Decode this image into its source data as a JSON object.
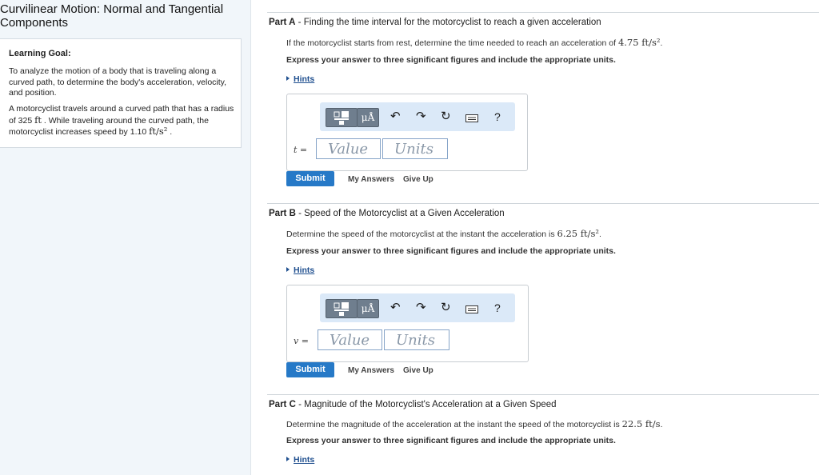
{
  "page": {
    "title": "Curvilinear Motion: Normal and Tangential Components"
  },
  "learning_goal": {
    "heading": "Learning Goal:",
    "text": "To analyze the motion of a body that is traveling along a curved path, to determine the body's acceleration, velocity, and position.",
    "problem_pre": "A motorcyclist travels around a curved path that has a radius of 325 ",
    "problem_unit1": "ft",
    "problem_mid": " . While traveling around the curved path, the motorcyclist increases speed by 1.10 ",
    "problem_unit2": "ft/s²",
    "problem_post": " ."
  },
  "toolbar": {
    "mu_label": "μÅ",
    "undo_icon": "undo-icon",
    "redo_icon": "redo-icon",
    "reset_icon": "reset-icon",
    "keyboard_icon": "keyboard-icon",
    "help_label": "?"
  },
  "parts": [
    {
      "label": "Part A",
      "title": "Finding the time interval for the motorcyclist to reach a given acceleration",
      "prompt_text": "If the motorcyclist starts from rest, determine the time needed to reach an acceleration of ",
      "prompt_math": "4.75 ft/s²",
      "prompt_end": ".",
      "instruction": "Express your answer to three significant figures and include the appropriate units.",
      "hints_label": "Hints",
      "variable": "t =",
      "value_placeholder": "Value",
      "units_placeholder": "Units",
      "submit_label": "Submit",
      "my_answers_label": "My Answers",
      "give_up_label": "Give Up"
    },
    {
      "label": "Part B",
      "title": "Speed of the Motorcyclist at a Given Acceleration",
      "prompt_text": "Determine the speed of the motorcyclist at the instant the acceleration is ",
      "prompt_math": "6.25 ft/s²",
      "prompt_end": ".",
      "instruction": "Express your answer to three significant figures and include the appropriate units.",
      "hints_label": "Hints",
      "variable": "v =",
      "value_placeholder": "Value",
      "units_placeholder": "Units",
      "submit_label": "Submit",
      "my_answers_label": "My Answers",
      "give_up_label": "Give Up"
    },
    {
      "label": "Part C",
      "title": "Magnitude of the Motorcyclist's Acceleration at a Given Speed",
      "prompt_text": "Determine the magnitude of the acceleration at the instant the speed of the motorcyclist is ",
      "prompt_math": "22.5 ft/s",
      "prompt_end": ".",
      "instruction": "Express your answer to three significant figures and include the appropriate units.",
      "hints_label": "Hints"
    }
  ]
}
